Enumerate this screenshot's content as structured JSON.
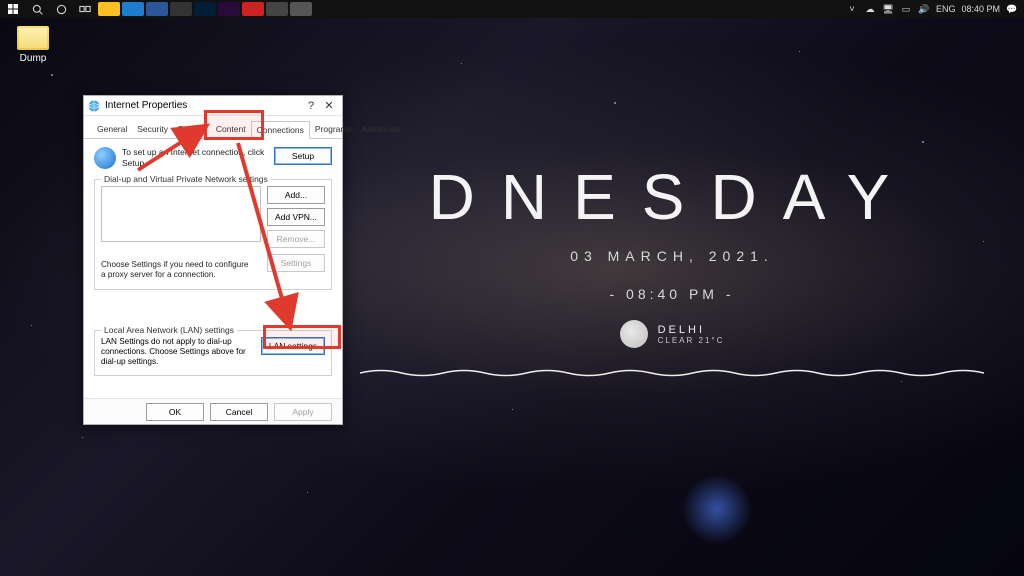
{
  "taskbar": {
    "apps": [
      "explorer",
      "edge",
      "word",
      "terminal",
      "photoshop",
      "premiere",
      "epic",
      "misc",
      "misc2"
    ],
    "tray": {
      "lang": "ENG",
      "time": "08:40 PM"
    }
  },
  "desktop": {
    "icon_label": "Dump"
  },
  "widget": {
    "day": "DNESDAY",
    "date": "03  MARCH,  2021.",
    "time": "- 08:40 PM -",
    "city": "DELHI",
    "condition": "CLEAR 21°C"
  },
  "dialog": {
    "title": "Internet Properties",
    "tabs": {
      "general": "General",
      "security": "Security",
      "privacy": "Privacy",
      "content": "Content",
      "connections": "Connections",
      "programs": "Programs",
      "advanced": "Advanced"
    },
    "setup_text": "To set up an Internet connection, click Setup.",
    "setup_btn": "Setup",
    "dialup_legend": "Dial-up and Virtual Private Network settings",
    "add_btn": "Add...",
    "add_vpn_btn": "Add VPN...",
    "remove_btn": "Remove...",
    "dialup_settings_btn": "Settings",
    "dialup_note": "Choose Settings if you need to configure a proxy server for a connection.",
    "lan_legend": "Local Area Network (LAN) settings",
    "lan_text": "LAN Settings do not apply to dial-up connections. Choose Settings above for dial-up settings.",
    "lan_btn": "LAN settings",
    "ok": "OK",
    "cancel": "Cancel",
    "apply": "Apply"
  }
}
